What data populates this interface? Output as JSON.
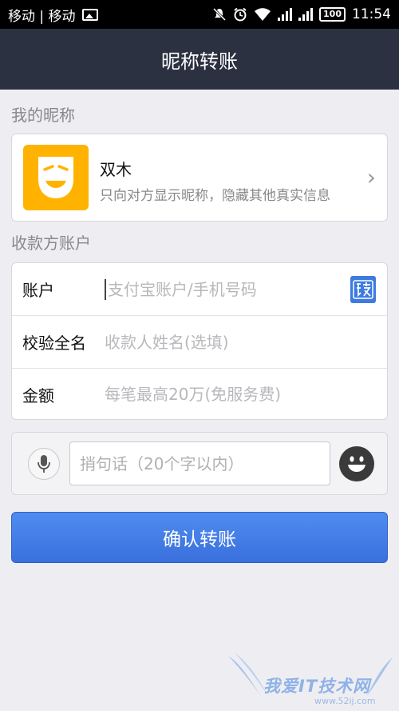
{
  "status_bar": {
    "carrier": "移动 | 移动",
    "battery": "100",
    "time": "11:54",
    "icons": [
      "image-icon",
      "mute-icon",
      "alarm-icon",
      "wifi-icon",
      "signal-icon",
      "signal-icon",
      "battery-icon"
    ]
  },
  "header": {
    "title": "昵称转账"
  },
  "nickname_section": {
    "label": "我的昵称",
    "name": "双木",
    "description": "只向对方显示昵称，隐藏其他真实信息",
    "avatar_color": "#ffb300"
  },
  "payee_section": {
    "label": "收款方账户",
    "rows": [
      {
        "label": "账户",
        "placeholder": "支付宝账户/手机号码"
      },
      {
        "label": "校验全名",
        "placeholder": "收款人姓名(选填)"
      },
      {
        "label": "金额",
        "placeholder": "每笔最高20万(免服务费)"
      }
    ]
  },
  "message": {
    "placeholder": "捎句话（20个字以内）"
  },
  "confirm_button": {
    "label": "确认转账",
    "color": "#3f78e3"
  },
  "watermark": {
    "text": "我爱IT技术网",
    "url": "www.52ij.com"
  }
}
